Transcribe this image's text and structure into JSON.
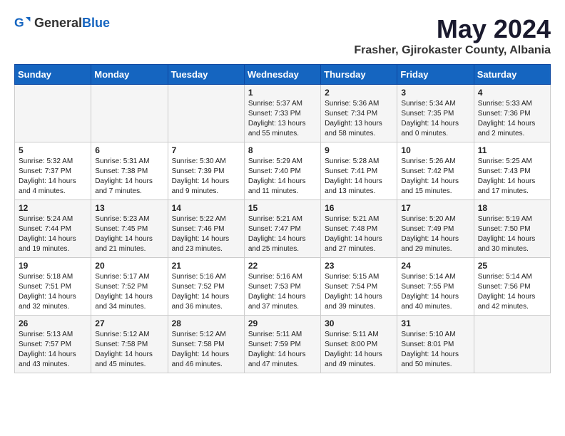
{
  "header": {
    "logo_general": "General",
    "logo_blue": "Blue",
    "month_year": "May 2024",
    "location": "Frasher, Gjirokaster County, Albania"
  },
  "days_of_week": [
    "Sunday",
    "Monday",
    "Tuesday",
    "Wednesday",
    "Thursday",
    "Friday",
    "Saturday"
  ],
  "weeks": [
    [
      {
        "day": "",
        "info": ""
      },
      {
        "day": "",
        "info": ""
      },
      {
        "day": "",
        "info": ""
      },
      {
        "day": "1",
        "info": "Sunrise: 5:37 AM\nSunset: 7:33 PM\nDaylight: 13 hours\nand 55 minutes."
      },
      {
        "day": "2",
        "info": "Sunrise: 5:36 AM\nSunset: 7:34 PM\nDaylight: 13 hours\nand 58 minutes."
      },
      {
        "day": "3",
        "info": "Sunrise: 5:34 AM\nSunset: 7:35 PM\nDaylight: 14 hours\nand 0 minutes."
      },
      {
        "day": "4",
        "info": "Sunrise: 5:33 AM\nSunset: 7:36 PM\nDaylight: 14 hours\nand 2 minutes."
      }
    ],
    [
      {
        "day": "5",
        "info": "Sunrise: 5:32 AM\nSunset: 7:37 PM\nDaylight: 14 hours\nand 4 minutes."
      },
      {
        "day": "6",
        "info": "Sunrise: 5:31 AM\nSunset: 7:38 PM\nDaylight: 14 hours\nand 7 minutes."
      },
      {
        "day": "7",
        "info": "Sunrise: 5:30 AM\nSunset: 7:39 PM\nDaylight: 14 hours\nand 9 minutes."
      },
      {
        "day": "8",
        "info": "Sunrise: 5:29 AM\nSunset: 7:40 PM\nDaylight: 14 hours\nand 11 minutes."
      },
      {
        "day": "9",
        "info": "Sunrise: 5:28 AM\nSunset: 7:41 PM\nDaylight: 14 hours\nand 13 minutes."
      },
      {
        "day": "10",
        "info": "Sunrise: 5:26 AM\nSunset: 7:42 PM\nDaylight: 14 hours\nand 15 minutes."
      },
      {
        "day": "11",
        "info": "Sunrise: 5:25 AM\nSunset: 7:43 PM\nDaylight: 14 hours\nand 17 minutes."
      }
    ],
    [
      {
        "day": "12",
        "info": "Sunrise: 5:24 AM\nSunset: 7:44 PM\nDaylight: 14 hours\nand 19 minutes."
      },
      {
        "day": "13",
        "info": "Sunrise: 5:23 AM\nSunset: 7:45 PM\nDaylight: 14 hours\nand 21 minutes."
      },
      {
        "day": "14",
        "info": "Sunrise: 5:22 AM\nSunset: 7:46 PM\nDaylight: 14 hours\nand 23 minutes."
      },
      {
        "day": "15",
        "info": "Sunrise: 5:21 AM\nSunset: 7:47 PM\nDaylight: 14 hours\nand 25 minutes."
      },
      {
        "day": "16",
        "info": "Sunrise: 5:21 AM\nSunset: 7:48 PM\nDaylight: 14 hours\nand 27 minutes."
      },
      {
        "day": "17",
        "info": "Sunrise: 5:20 AM\nSunset: 7:49 PM\nDaylight: 14 hours\nand 29 minutes."
      },
      {
        "day": "18",
        "info": "Sunrise: 5:19 AM\nSunset: 7:50 PM\nDaylight: 14 hours\nand 30 minutes."
      }
    ],
    [
      {
        "day": "19",
        "info": "Sunrise: 5:18 AM\nSunset: 7:51 PM\nDaylight: 14 hours\nand 32 minutes."
      },
      {
        "day": "20",
        "info": "Sunrise: 5:17 AM\nSunset: 7:52 PM\nDaylight: 14 hours\nand 34 minutes."
      },
      {
        "day": "21",
        "info": "Sunrise: 5:16 AM\nSunset: 7:52 PM\nDaylight: 14 hours\nand 36 minutes."
      },
      {
        "day": "22",
        "info": "Sunrise: 5:16 AM\nSunset: 7:53 PM\nDaylight: 14 hours\nand 37 minutes."
      },
      {
        "day": "23",
        "info": "Sunrise: 5:15 AM\nSunset: 7:54 PM\nDaylight: 14 hours\nand 39 minutes."
      },
      {
        "day": "24",
        "info": "Sunrise: 5:14 AM\nSunset: 7:55 PM\nDaylight: 14 hours\nand 40 minutes."
      },
      {
        "day": "25",
        "info": "Sunrise: 5:14 AM\nSunset: 7:56 PM\nDaylight: 14 hours\nand 42 minutes."
      }
    ],
    [
      {
        "day": "26",
        "info": "Sunrise: 5:13 AM\nSunset: 7:57 PM\nDaylight: 14 hours\nand 43 minutes."
      },
      {
        "day": "27",
        "info": "Sunrise: 5:12 AM\nSunset: 7:58 PM\nDaylight: 14 hours\nand 45 minutes."
      },
      {
        "day": "28",
        "info": "Sunrise: 5:12 AM\nSunset: 7:58 PM\nDaylight: 14 hours\nand 46 minutes."
      },
      {
        "day": "29",
        "info": "Sunrise: 5:11 AM\nSunset: 7:59 PM\nDaylight: 14 hours\nand 47 minutes."
      },
      {
        "day": "30",
        "info": "Sunrise: 5:11 AM\nSunset: 8:00 PM\nDaylight: 14 hours\nand 49 minutes."
      },
      {
        "day": "31",
        "info": "Sunrise: 5:10 AM\nSunset: 8:01 PM\nDaylight: 14 hours\nand 50 minutes."
      },
      {
        "day": "",
        "info": ""
      }
    ]
  ]
}
